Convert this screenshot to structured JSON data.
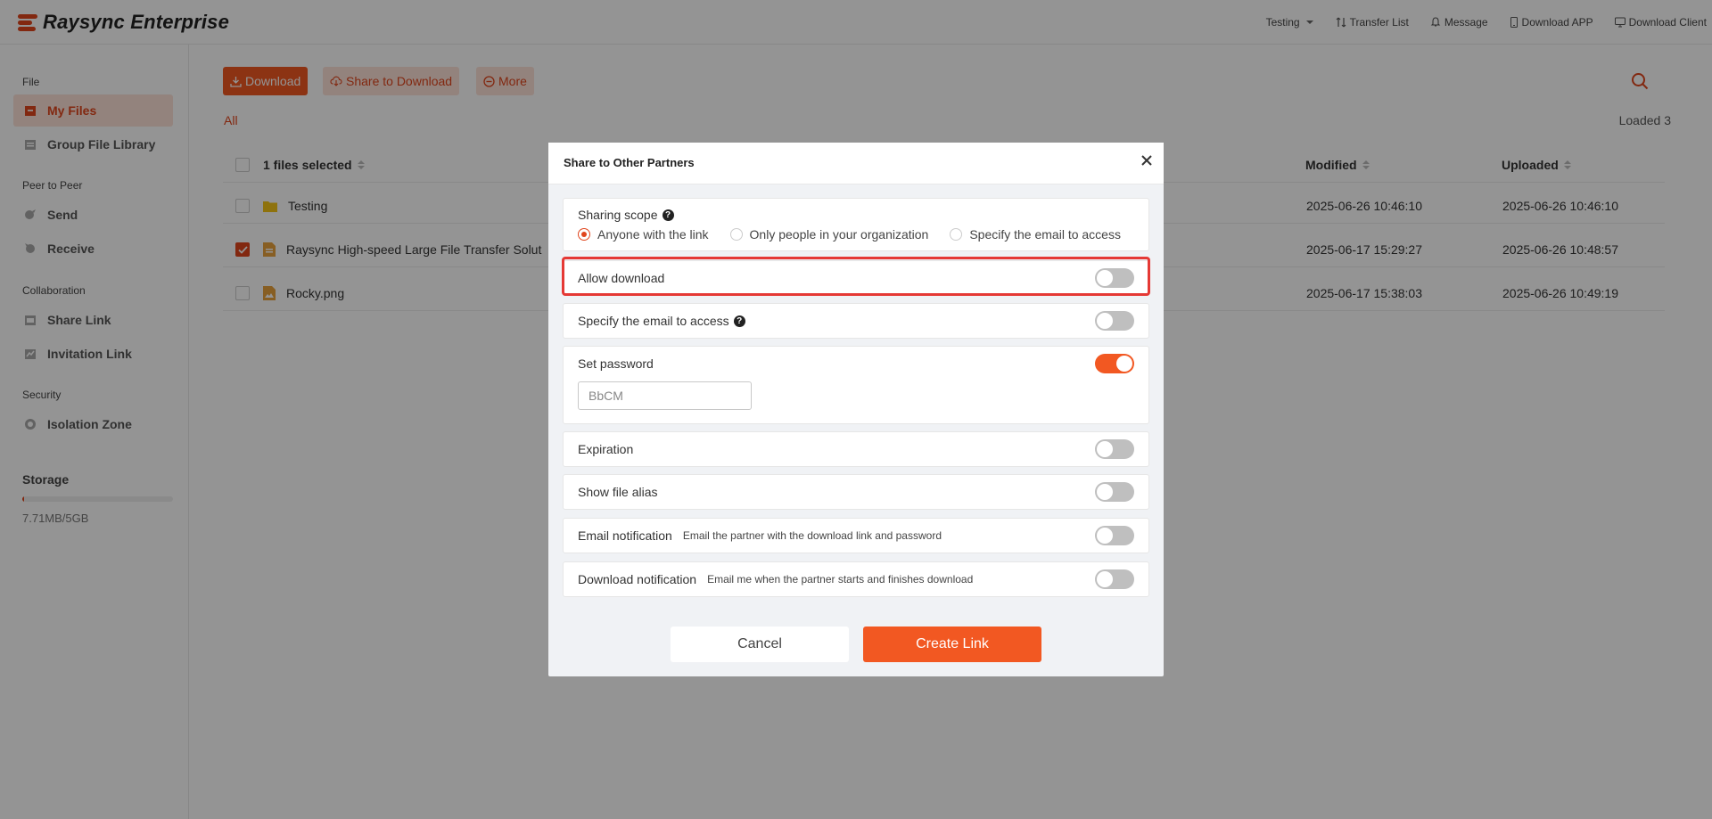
{
  "header": {
    "app_title": "Raysync Enterprise",
    "user": "Testing",
    "transfer_list": "Transfer List",
    "message": "Message",
    "download_app": "Download APP",
    "download_client": "Download Client"
  },
  "sidebar": {
    "sections": {
      "file": "File",
      "p2p": "Peer to Peer",
      "collab": "Collaboration",
      "security": "Security"
    },
    "items": {
      "my_files": "My Files",
      "group_library": "Group File Library",
      "send": "Send",
      "receive": "Receive",
      "share_link": "Share Link",
      "invitation_link": "Invitation Link",
      "isolation_zone": "Isolation Zone"
    },
    "storage": {
      "title": "Storage",
      "usage_text": "7.71MB/5GB",
      "used_fraction": 0.0015
    }
  },
  "toolbar": {
    "download": "Download",
    "share_to_download": "Share to Download",
    "more": "More"
  },
  "breadcrumb": "All",
  "loaded": "Loaded 3",
  "table": {
    "headers": {
      "name": "1 files selected",
      "modified": "Modified",
      "uploaded": "Uploaded"
    },
    "rows": [
      {
        "name": "Testing",
        "modified": "2025-06-26 10:46:10",
        "uploaded": "2025-06-26 10:46:10"
      },
      {
        "name": "Raysync High-speed Large File Transfer Solut",
        "modified": "2025-06-17 15:29:27",
        "uploaded": "2025-06-26 10:48:57"
      },
      {
        "name": "Rocky.png",
        "modified": "2025-06-17 15:38:03",
        "uploaded": "2025-06-26 10:49:19"
      }
    ]
  },
  "modal": {
    "title": "Share to Other Partners",
    "sharing_scope": {
      "label": "Sharing scope",
      "options": [
        "Anyone with the link",
        "Only people in your organization",
        "Specify the email to access"
      ]
    },
    "allow_download": "Allow download",
    "specify_email": "Specify the email to access",
    "set_password": {
      "label": "Set password",
      "value": "BbCM"
    },
    "expiration": "Expiration",
    "show_alias": "Show file alias",
    "email_notification": {
      "label": "Email notification",
      "desc": "Email the partner with the download link and password"
    },
    "download_notification": {
      "label": "Download notification",
      "desc": "Email me when the partner starts and finishes download"
    },
    "cancel": "Cancel",
    "create": "Create Link"
  },
  "colors": {
    "accent": "#f25822",
    "highlight": "#e53935"
  }
}
